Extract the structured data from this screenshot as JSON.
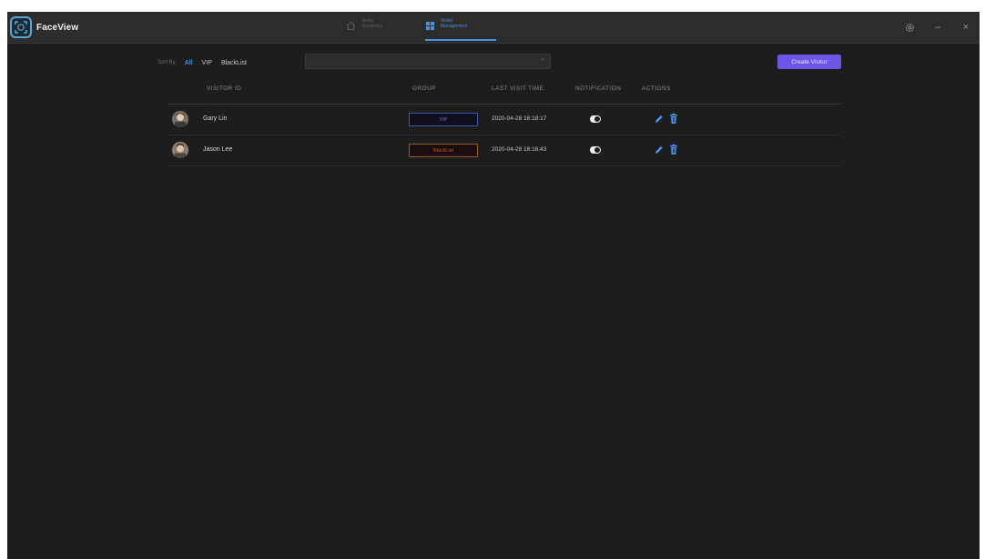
{
  "app": {
    "title": "FaceView",
    "logo_icon": "face-scan-icon"
  },
  "nav": {
    "tabs": [
      {
        "label_line1": "Visitor",
        "label_line2": "Monitoring",
        "icon": "home-icon",
        "active": false
      },
      {
        "label_line1": "Visitor",
        "label_line2": "Management",
        "icon": "grid-icon",
        "active": true
      }
    ]
  },
  "window_controls": {
    "settings_icon": "gear-icon",
    "minimize": "–",
    "close": "×"
  },
  "toolbar": {
    "sort_label": "Sort By",
    "sort_options": [
      "All",
      "VIP",
      "BlackList"
    ],
    "selected_sort": "All",
    "search": {
      "value": "",
      "clear": "×"
    },
    "create_button": "Create Visitor"
  },
  "table": {
    "columns": [
      "VISITOR ID",
      "GROUP",
      "LAST VISIT TIME",
      "NOTIFICATION",
      "ACTIONS"
    ],
    "rows": [
      {
        "name": "Gary Lin",
        "group": "VIP",
        "last_visit": "2020-04-28 16:18:17",
        "notification": true
      },
      {
        "name": "Jason Lee",
        "group": "BlackList",
        "last_visit": "2020-04-28 16:16:43",
        "notification": true
      }
    ]
  },
  "colors": {
    "accent": "#4a90e2",
    "primary_button": "#6f55e6",
    "vip_border": "#3c58a8",
    "blacklist_border": "#9a5a1a",
    "background": "#1d1d1d"
  }
}
